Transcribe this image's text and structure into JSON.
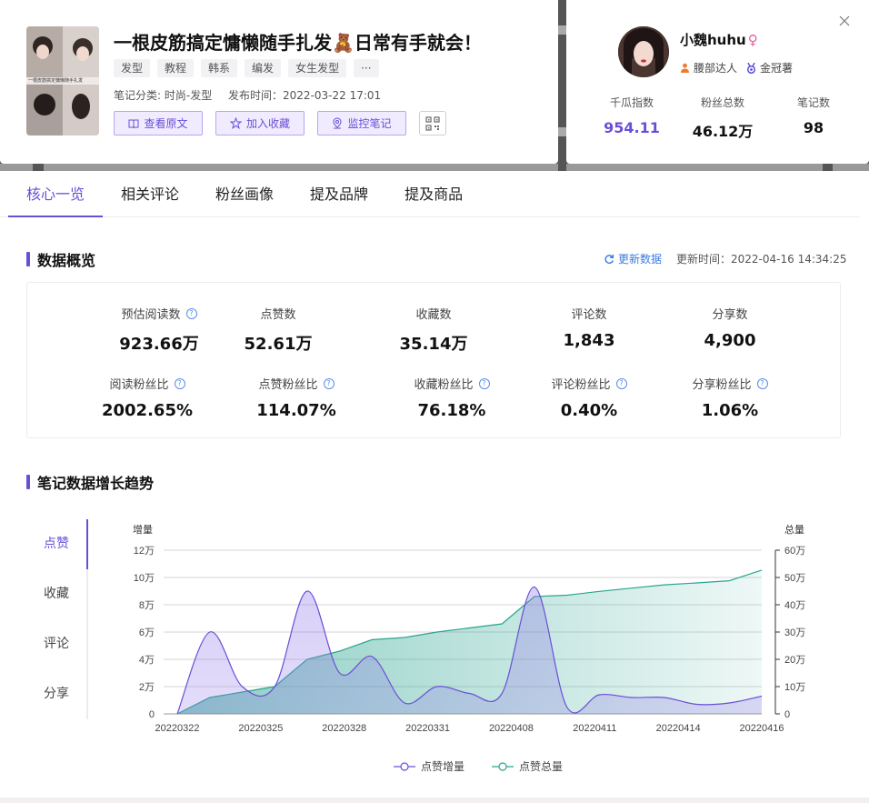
{
  "note": {
    "title": "一根皮筋搞定慵懒随手扎发🧸日常有手就会！",
    "tags": [
      "发型",
      "教程",
      "韩系",
      "编发",
      "女生发型",
      "···"
    ],
    "category": "笔记分类: 时尚-发型",
    "publish_time": "发布时间：2022-03-22 17:01",
    "thumbnail_caption": "一根皮筋搞定慵懒随手扎发",
    "buttons": {
      "view_original": "查看原文",
      "add_favorite": "加入收藏",
      "monitor_note": "监控笔记"
    }
  },
  "profile": {
    "name": "小魏huhu",
    "gender_symbol": "♀",
    "badges": [
      "腰部达人",
      "金冠薯"
    ],
    "stats": [
      {
        "label": "千瓜指数",
        "value": "954.11"
      },
      {
        "label": "粉丝总数",
        "value": "46.12万"
      },
      {
        "label": "笔记数",
        "value": "98"
      }
    ]
  },
  "tabs": [
    "核心一览",
    "相关评论",
    "粉丝画像",
    "提及品牌",
    "提及商品"
  ],
  "overview": {
    "title": "数据概览",
    "refresh_label": "更新数据",
    "update_time": "更新时间：2022-04-16 14:34:25",
    "row1": [
      {
        "label": "预估阅读数",
        "value": "923.66万",
        "help": true
      },
      {
        "label": "点赞数",
        "value": "52.61万",
        "help": false
      },
      {
        "label": "收藏数",
        "value": "35.14万",
        "help": false
      },
      {
        "label": "评论数",
        "value": "1,843",
        "help": false
      },
      {
        "label": "分享数",
        "value": "4,900",
        "help": false
      }
    ],
    "row2": [
      {
        "label": "阅读粉丝比",
        "value": "2002.65%",
        "help": true
      },
      {
        "label": "点赞粉丝比",
        "value": "114.07%",
        "help": true
      },
      {
        "label": "收藏粉丝比",
        "value": "76.18%",
        "help": true
      },
      {
        "label": "评论粉丝比",
        "value": "0.40%",
        "help": true
      },
      {
        "label": "分享粉丝比",
        "value": "1.06%",
        "help": true
      }
    ]
  },
  "trend": {
    "title": "笔记数据增长趋势",
    "metric_tabs": [
      "点赞",
      "收藏",
      "评论",
      "分享"
    ],
    "legend": [
      "点赞增量",
      "点赞总量"
    ]
  },
  "colors": {
    "accent": "#6a4fd6",
    "teal": "#2aa590",
    "link": "#3a7be0"
  },
  "chart_data": {
    "type": "area",
    "x_tick_labels": [
      "20220322",
      "20220325",
      "20220328",
      "20220331",
      "20220408",
      "20220411",
      "20220414",
      "20220416"
    ],
    "left_axis": {
      "label": "增量",
      "ticks": [
        "0",
        "2万",
        "4万",
        "6万",
        "8万",
        "10万",
        "12万"
      ],
      "ylim": [
        0,
        120000
      ]
    },
    "right_axis": {
      "label": "总量",
      "ticks": [
        "0",
        "10万",
        "20万",
        "30万",
        "40万",
        "50万",
        "60万"
      ],
      "ylim": [
        0,
        600000
      ]
    },
    "grid": true,
    "legend_position": "bottom-center",
    "series": [
      {
        "name": "点赞增量",
        "axis": "left",
        "values": [
          0,
          60000,
          20000,
          20000,
          90000,
          30000,
          42000,
          8000,
          20000,
          15000,
          15000,
          93000,
          5000,
          14000,
          12000,
          12000,
          7000,
          8000,
          13000
        ]
      },
      {
        "name": "点赞总量",
        "axis": "left",
        "values": [
          0,
          60000,
          80000,
          100000,
          200000,
          230000,
          272000,
          280000,
          300000,
          315000,
          330000,
          430000,
          435000,
          449000,
          461000,
          473000,
          480000,
          488000,
          527000
        ]
      }
    ]
  }
}
